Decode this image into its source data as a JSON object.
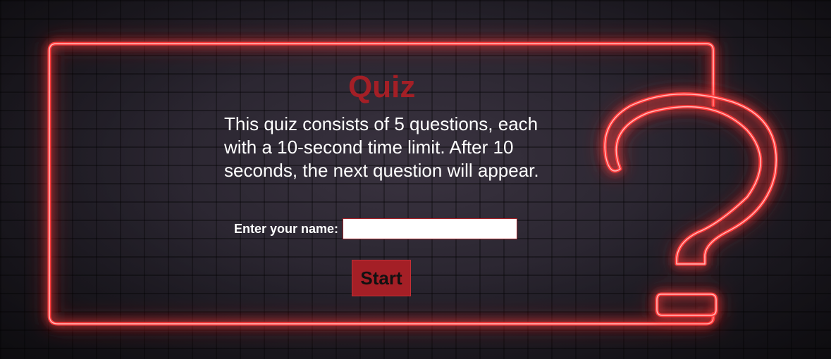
{
  "quiz": {
    "title": "Quiz",
    "description": "This quiz consists of 5 questions, each with a 10-second time limit. After 10 seconds, the next question will appear.",
    "name_label": "Enter your name:",
    "name_value": "",
    "start_label": "Start"
  },
  "colors": {
    "neon_red": "#ff2a2a",
    "accent": "#a41f26",
    "text": "#ffffff"
  },
  "icons": {
    "question_mark": "neon-question-mark-icon"
  }
}
